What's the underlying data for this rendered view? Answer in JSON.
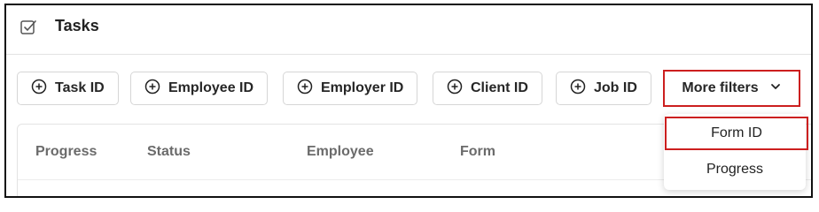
{
  "header": {
    "title": "Tasks",
    "icon": "checkbox-icon"
  },
  "filters": [
    {
      "label": "Task ID",
      "icon": "plus-circle-icon"
    },
    {
      "label": "Employee ID",
      "icon": "plus-circle-icon"
    },
    {
      "label": "Employer ID",
      "icon": "plus-circle-icon"
    },
    {
      "label": "Client ID",
      "icon": "plus-circle-icon"
    },
    {
      "label": "Job ID",
      "icon": "plus-circle-icon"
    }
  ],
  "more_filters": {
    "label": "More filters",
    "icon": "chevron-down-icon"
  },
  "dropdown": {
    "items": [
      {
        "label": "Form ID",
        "highlighted": true
      },
      {
        "label": "Progress",
        "highlighted": false
      }
    ]
  },
  "table": {
    "columns": [
      "Progress",
      "Status",
      "Employee",
      "Form"
    ]
  },
  "colors": {
    "highlight": "#cc1f1f",
    "border": "#d6d6d6"
  }
}
